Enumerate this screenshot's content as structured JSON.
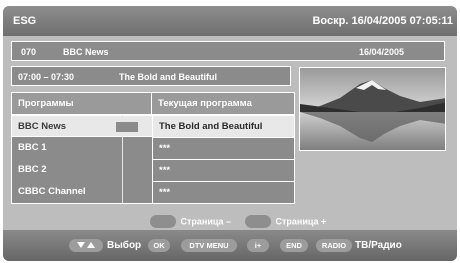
{
  "header": {
    "title": "ESG",
    "clock": "Воскр.  16/04/2005  07:05:11"
  },
  "channel_bar": {
    "number": "070",
    "name": "BBC News",
    "date": "16/04/2005"
  },
  "program_bar": {
    "time": "07:00 – 07:30",
    "title": "The Bold and Beautiful"
  },
  "grid": {
    "col_channels": "Программы",
    "col_current": "Текущая программа",
    "channels": [
      "BBC News",
      "BBC 1",
      "BBC 2",
      "CBBC Channel"
    ],
    "programs": [
      "The Bold and Beautiful",
      "***",
      "***",
      "***"
    ]
  },
  "pager": {
    "prev_label": "Страница –",
    "next_label": "Страница +"
  },
  "footer": {
    "select_label": "Выбор",
    "ok_label": "OK",
    "dtv_menu_label": "DTV MENU",
    "info_label": "i+",
    "end_label": "END",
    "radio_label": "RADIO",
    "tv_radio_label": "ТВ/Радио"
  }
}
